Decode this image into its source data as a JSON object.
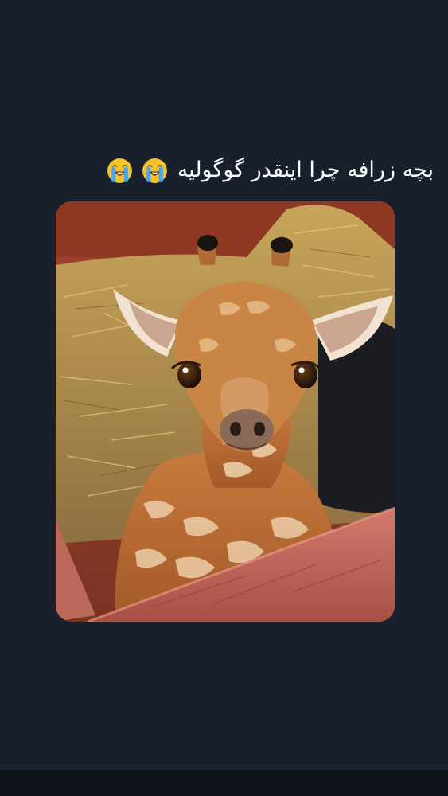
{
  "post": {
    "caption_text": "بچه زرافه چرا اینقدر گوگولیه",
    "emojis": [
      "loudly-crying-face-icon",
      "loudly-crying-face-icon"
    ]
  },
  "photo": {
    "subject": "baby-giraffe"
  },
  "colors": {
    "background": "#18202b",
    "caption": "#ffffff",
    "bottom_bar": "#0d1218"
  }
}
